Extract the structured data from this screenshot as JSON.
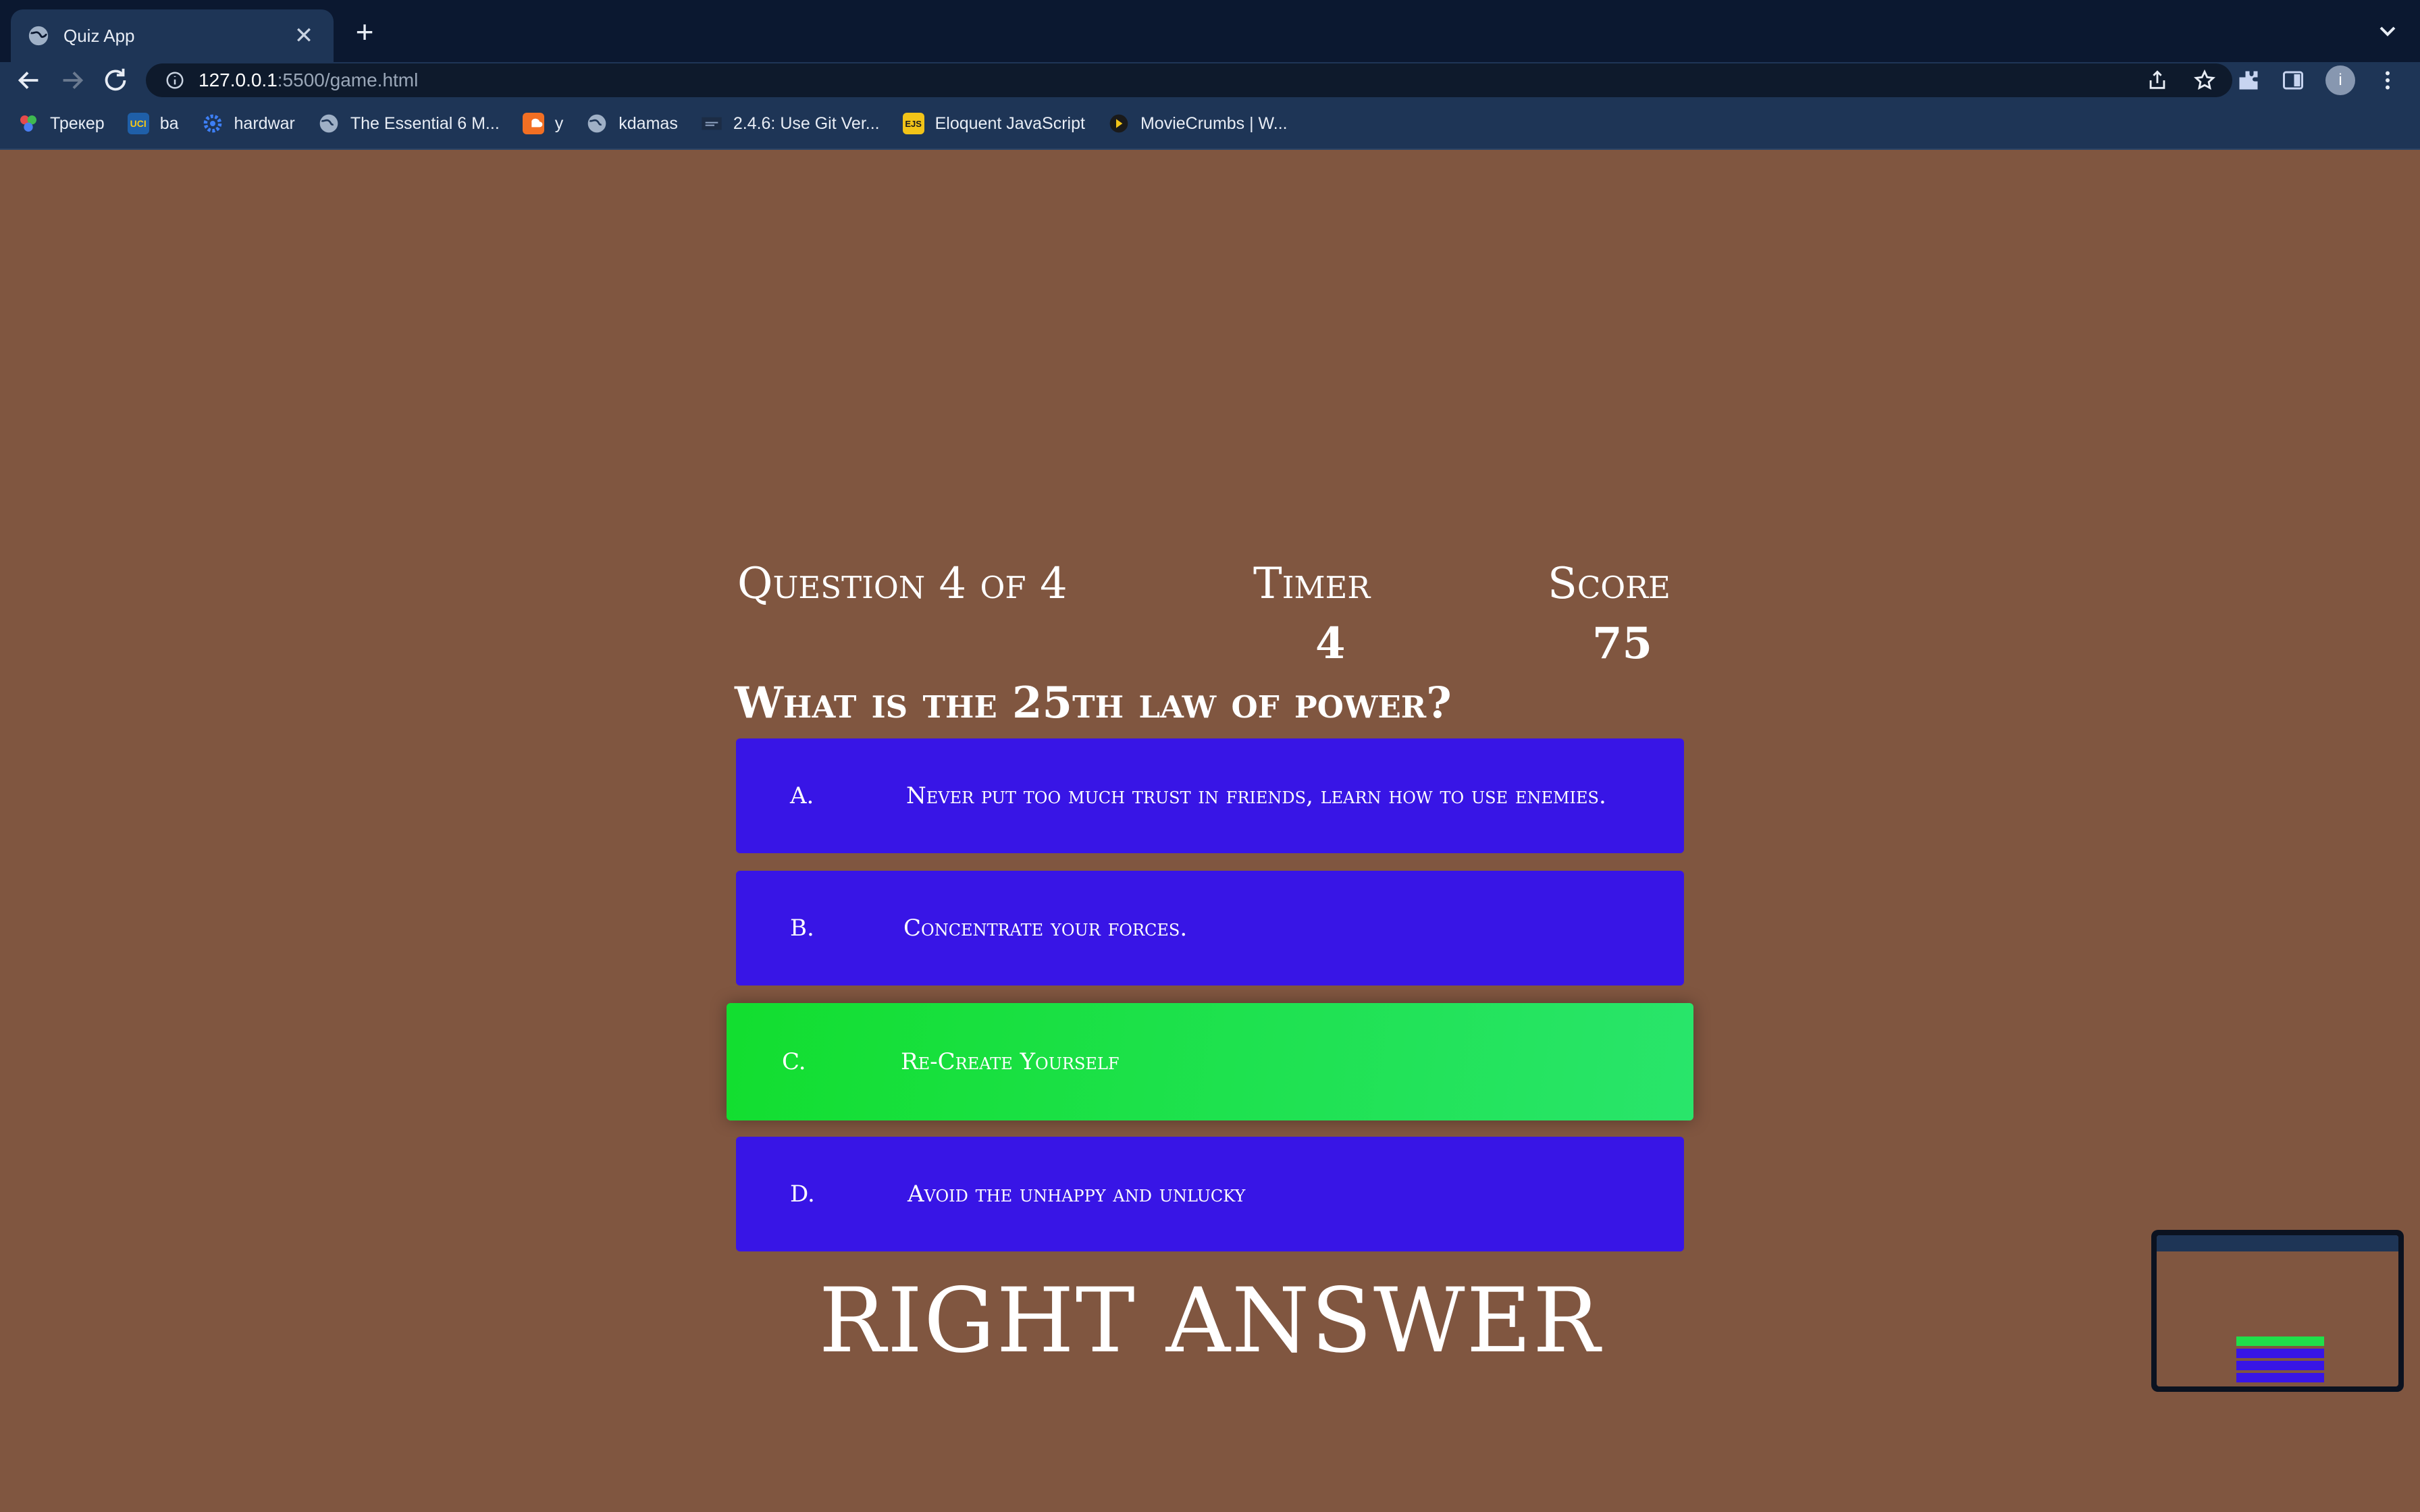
{
  "browser": {
    "tab_title": "Quiz App",
    "tab_close": "✕",
    "new_tab": "+",
    "url_host": "127.0.0.1",
    "url_path": ":5500/game.html",
    "avatar_letter": "i",
    "bookmarks": [
      {
        "label": "Трекер",
        "icon": "tracker-icon"
      },
      {
        "label": "ba",
        "icon": "uci-icon",
        "icon_text": "UCI"
      },
      {
        "label": "hardwar",
        "icon": "gear-icon"
      },
      {
        "label": "The Essential 6 M...",
        "icon": "globe-icon"
      },
      {
        "label": "y",
        "icon": "soundcloud-icon"
      },
      {
        "label": "kdamas",
        "icon": "globe-icon"
      },
      {
        "label": "2.4.6: Use Git Ver...",
        "icon": "page-icon"
      },
      {
        "label": "Eloquent JavaScript",
        "icon": "ejs-icon",
        "icon_text": "EJS"
      },
      {
        "label": "MovieCrumbs | W...",
        "icon": "moviecrumbs-icon"
      }
    ]
  },
  "quiz": {
    "progress_text": "Question 4 of 4",
    "timer_label": "Timer",
    "timer_value": "4",
    "score_label": "Score",
    "score_value": "75",
    "question": "What is the 25th law of power?",
    "choices": [
      {
        "prefix": "A.",
        "text": "Never put too much trust in friends, learn how to use enemies.",
        "state": "default"
      },
      {
        "prefix": "B.",
        "text": "Concentrate your forces.",
        "state": "default"
      },
      {
        "prefix": "C.",
        "text": "Re-Create Yourself",
        "state": "correct"
      },
      {
        "prefix": "D.",
        "text": "Avoid the unhappy and unlucky",
        "state": "default"
      }
    ],
    "feedback": "RIGHT ANSWER"
  },
  "colors": {
    "page_bg": "#805640",
    "choice_bg": "#3815e6",
    "correct_from": "#12de2f",
    "correct_to": "#29e56b",
    "chrome_bg": "#1e3556"
  }
}
